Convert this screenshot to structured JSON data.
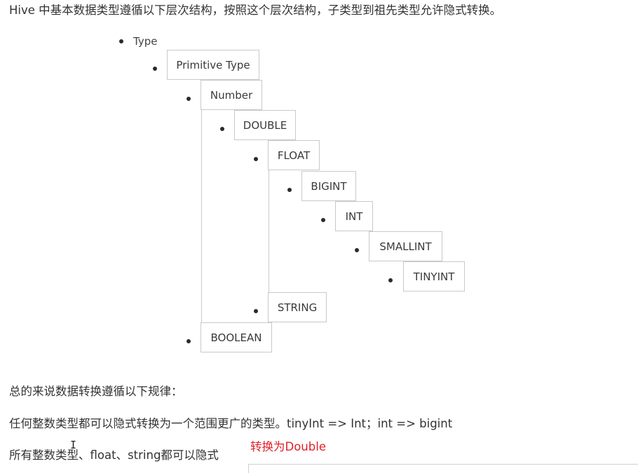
{
  "intro": "Hive 中基本数据类型遵循以下层次结构，按照这个层次结构，子类型到祖先类型允许隐式转换。",
  "hierarchy": {
    "root": "Type",
    "primitive": "Primitive Type",
    "number": "Number",
    "double": "DOUBLE",
    "float": "FLOAT",
    "bigint": "BIGINT",
    "int": "INT",
    "smallint": "SMALLINT",
    "tinyint": "TINYINT",
    "string": "STRING",
    "boolean": "BOOLEAN"
  },
  "rules": {
    "heading": "总的来说数据转换遵循以下规律：",
    "rule1": "任何整数类型都可以隐式转换为一个范围更广的类型。tinyInt => Int；int => bigint",
    "rule2": "所有整数类型、float、string都可以隐式",
    "rule2_note": "转换为Double"
  },
  "cursor_glyph": "I"
}
